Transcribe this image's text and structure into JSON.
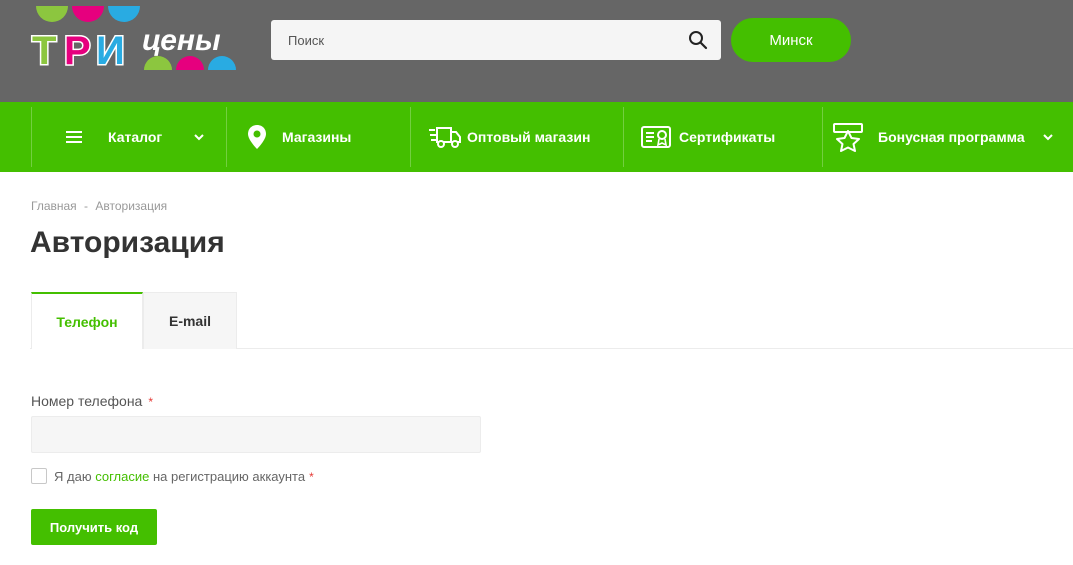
{
  "header": {
    "logo_text_main": "ТРИ",
    "logo_text_sub": "цены",
    "search": {
      "placeholder": "Поиск"
    },
    "city_label": "Минск"
  },
  "nav": {
    "items": [
      {
        "label": "Каталог",
        "icon": "menu-icon",
        "has_dropdown": true
      },
      {
        "label": "Магазины",
        "icon": "location-pin-icon",
        "has_dropdown": false
      },
      {
        "label": "Оптовый магазин",
        "icon": "delivery-truck-icon",
        "has_dropdown": false
      },
      {
        "label": "Сертификаты",
        "icon": "certificate-icon",
        "has_dropdown": false
      },
      {
        "label": "Бонусная программа",
        "icon": "star-badge-icon",
        "has_dropdown": true
      }
    ]
  },
  "breadcrumb": {
    "home": "Главная",
    "separator": "-",
    "current": "Авторизация"
  },
  "page_title": "Авторизация",
  "tabs": [
    {
      "label": "Телефон",
      "active": true
    },
    {
      "label": "E-mail",
      "active": false
    }
  ],
  "form": {
    "phone_label": "Номер телефона",
    "required_mark": "*",
    "phone_value": "",
    "consent_before": "Я даю ",
    "consent_link": "согласие",
    "consent_after": " на регистрацию аккаунта",
    "submit_label": "Получить код"
  },
  "colors": {
    "accent": "#44bf00",
    "header_bg": "#666666",
    "required": "#e53935"
  }
}
